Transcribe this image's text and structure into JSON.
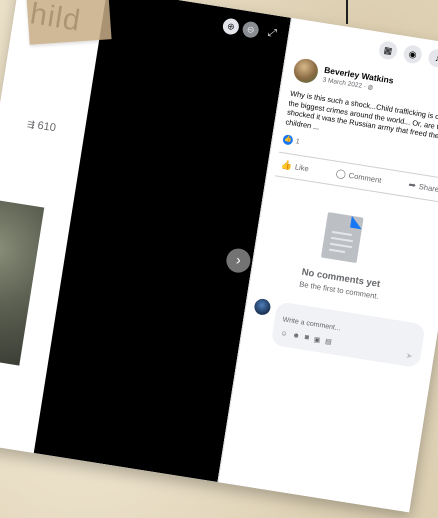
{
  "feed": {
    "heading_fragment": "hild",
    "share_count": "610",
    "share_icon": "share-icon"
  },
  "viewer": {
    "zoom_in_icon": "zoom-in-icon",
    "zoom_out_icon": "zoom-out-icon",
    "fullscreen_icon": "fullscreen-icon",
    "next_icon": "chevron-right-icon"
  },
  "top_bar": {
    "menu_icon": "menu-grid-icon",
    "messenger_icon": "messenger-icon",
    "notifications_icon": "bell-icon"
  },
  "post": {
    "author": "Beverley Watkins",
    "date": "3 March 2022",
    "audience_icon": "globe-icon",
    "text": "Why is this such a shock...Child trafficking is one of the biggest crimes around the world... Or, are they shocked it was the Russian army that freed these children ...",
    "reaction_count": "1",
    "reaction_color": "#1877f2",
    "actions": {
      "like": "Like",
      "comment": "Comment",
      "share": "Share"
    }
  },
  "comments": {
    "empty_title": "No comments yet",
    "empty_subtitle": "Be the first to comment.",
    "composer_placeholder": "Write a comment..."
  }
}
